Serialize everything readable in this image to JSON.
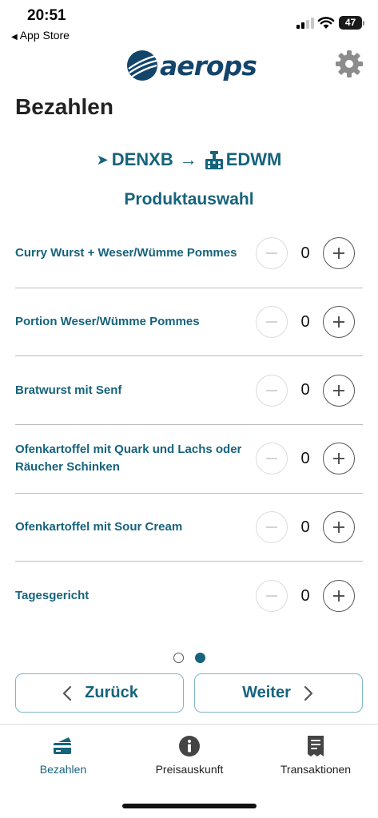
{
  "status_bar": {
    "time": "20:51",
    "back_app": "App Store",
    "battery": "47"
  },
  "header": {
    "logo_text": "aerops",
    "settings_icon": "gear-icon"
  },
  "page": {
    "title": "Bezahlen"
  },
  "route": {
    "from": "DENXB",
    "to": "EDWM",
    "from_icon": "departure-arrow-icon",
    "to_icon": "airport-tower-icon"
  },
  "section": {
    "title": "Produktauswahl"
  },
  "products": [
    {
      "name": "Curry Wurst + Weser/Wümme Pommes",
      "qty": "0"
    },
    {
      "name": "Portion Weser/Wümme Pommes",
      "qty": "0"
    },
    {
      "name": "Bratwurst mit Senf",
      "qty": "0"
    },
    {
      "name": "Ofenkartoffel mit Quark  und Lachs oder Räucher Schinken",
      "qty": "0"
    },
    {
      "name": "Ofenkartoffel mit Sour Cream",
      "qty": "0"
    },
    {
      "name": "Tagesgericht",
      "qty": "0"
    }
  ],
  "pager": {
    "pages": 2,
    "current": 2
  },
  "buttons": {
    "back_label": "Zurück",
    "next_label": "Weiter"
  },
  "tabbar": {
    "tabs": [
      {
        "label": "Bezahlen",
        "icon": "payment-card-icon",
        "active": true
      },
      {
        "label": "Preisauskunft",
        "icon": "info-icon",
        "active": false
      },
      {
        "label": "Transaktionen",
        "icon": "receipt-icon",
        "active": false
      }
    ]
  },
  "colors": {
    "accent": "#16637c",
    "brand": "#13456b",
    "button_border": "#7fb4c4"
  }
}
